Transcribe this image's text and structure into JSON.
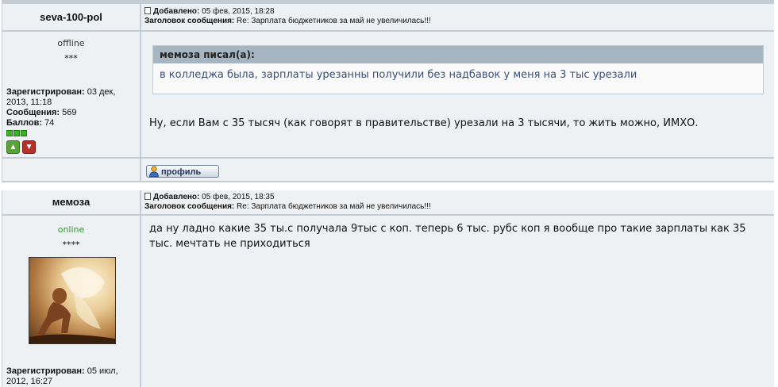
{
  "posts": [
    {
      "author": "seva-100-pol",
      "header": {
        "added_label": "Добавлено:",
        "added_value": "05 фев, 2015, 18:28",
        "subject_label": "Заголовок сообщения:",
        "subject_value": "Re: Зарплата бюджетников за май не увеличилась!!!"
      },
      "status": "offline",
      "status_color": "#333333",
      "stars": "***",
      "registered_label": "Зарегистрирован:",
      "registered_value": "03 дек, 2013, 11:18",
      "messages_label": "Сообщения:",
      "messages_value": "569",
      "points_label": "Баллов:",
      "points_value": "74",
      "quote": {
        "head": "мемоза писал(а):",
        "body": "в колледжа была, зарплаты урезанны получили без надбавок у меня на 3 тыс урезали"
      },
      "text": "Ну, если Вам с 35 тысяч (как говорят в правительстве) урезали на 3 тысячи, то жить можно, ИМХО.",
      "profile_button": "профиль"
    },
    {
      "author": "мемоза",
      "header": {
        "added_label": "Добавлено:",
        "added_value": "05 фев, 2015, 18:35",
        "subject_label": "Заголовок сообщения:",
        "subject_value": "Re: Зарплата бюджетников за май не увеличилась!!!"
      },
      "status": "online",
      "status_color": "#2a9a2a",
      "stars": "****",
      "registered_label": "Зарегистрирован:",
      "registered_value": "05 июл, 2012, 16:27",
      "text": "да ну ладно какие 35 ты.с получала 9тыс с коп. теперь 6 тыс. рубс коп я вообще про такие зарплаты как 35 тыс. мечтать не приходиться"
    }
  ]
}
